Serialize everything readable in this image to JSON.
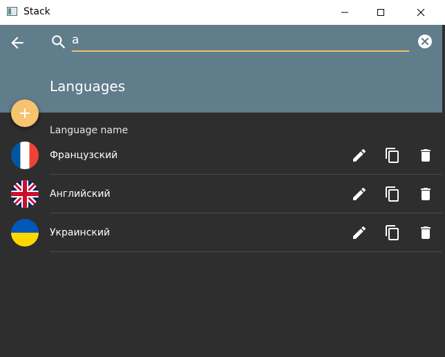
{
  "window": {
    "title": "Stack",
    "controls": [
      "minimize-icon",
      "maximize-icon",
      "close-icon"
    ]
  },
  "header": {
    "back_icon": "arrow-left-icon",
    "search_icon": "search-icon",
    "search_value": "a",
    "clear_icon": "clear-circle-icon",
    "title": "Languages",
    "accent_color": "#f2c268",
    "background_color": "#607d8b"
  },
  "fab": {
    "label": "+",
    "color": "#f6c36e"
  },
  "list": {
    "column_header": "Language name",
    "rows": [
      {
        "name": "Французский",
        "flag": "france-flag-icon"
      },
      {
        "name": "Английский",
        "flag": "uk-flag-icon"
      },
      {
        "name": "Украинский",
        "flag": "ukraine-flag-icon"
      }
    ],
    "actions": [
      "edit-icon",
      "copy-icon",
      "delete-icon"
    ]
  }
}
